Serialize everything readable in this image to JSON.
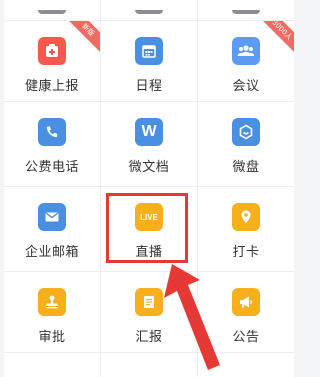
{
  "colors": {
    "red_icon": "#f5584d",
    "blue_icon": "#4a90e2",
    "blue_icon_light": "#5b9bf1",
    "orange_icon": "#f7b01c",
    "badge": "#f26b63",
    "highlight": "#e53935"
  },
  "grid": [
    [
      {
        "label": "",
        "icon": "top-stub"
      },
      {
        "label": "",
        "icon": "top-stub"
      },
      {
        "label": "",
        "icon": "top-stub"
      }
    ],
    [
      {
        "label": "健康上报",
        "icon": "health-report-icon",
        "badge": "新版"
      },
      {
        "label": "日程",
        "icon": "calendar-icon"
      },
      {
        "label": "会议",
        "icon": "meeting-icon",
        "badge": "3000人"
      }
    ],
    [
      {
        "label": "公费电话",
        "icon": "phone-icon"
      },
      {
        "label": "微文档",
        "icon": "document-icon",
        "icon_text": "W"
      },
      {
        "label": "微盘",
        "icon": "cloud-drive-icon"
      }
    ],
    [
      {
        "label": "企业邮箱",
        "icon": "mail-icon"
      },
      {
        "label": "直播",
        "icon": "live-icon",
        "icon_text": "LIVE",
        "highlighted": true
      },
      {
        "label": "打卡",
        "icon": "location-icon"
      }
    ],
    [
      {
        "label": "审批",
        "icon": "approval-stamp-icon"
      },
      {
        "label": "汇报",
        "icon": "report-icon"
      },
      {
        "label": "公告",
        "icon": "megaphone-icon"
      }
    ]
  ]
}
